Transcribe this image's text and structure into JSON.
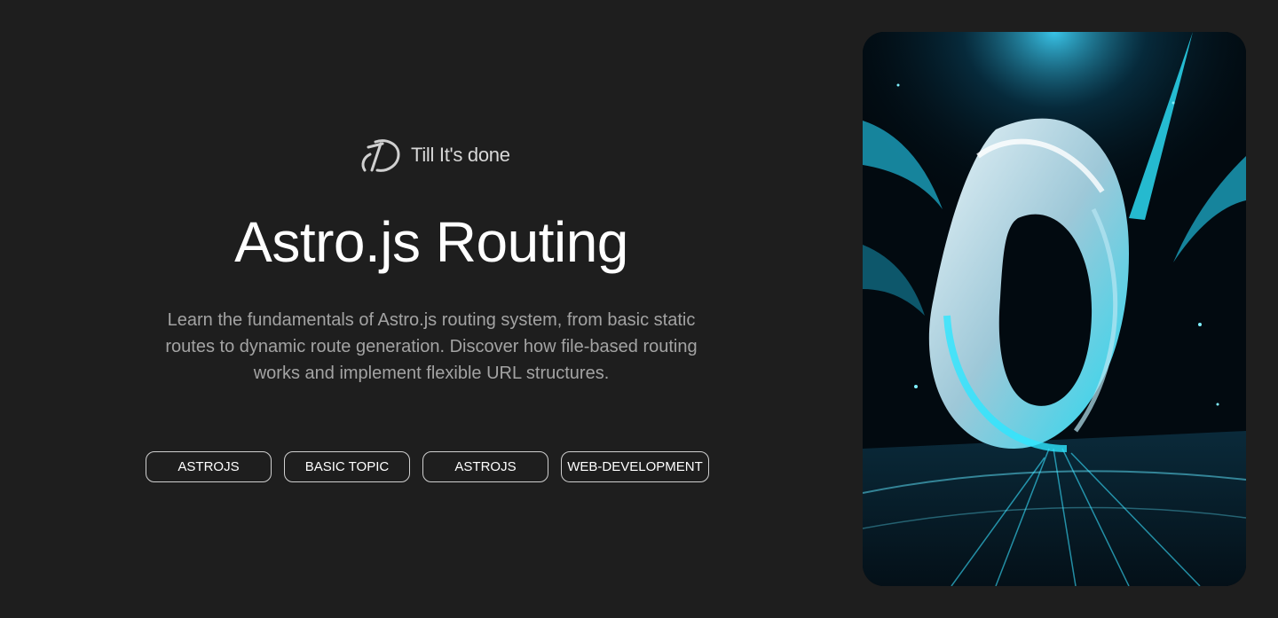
{
  "brand": {
    "name": "Till It's done",
    "logo_icon": "brand-logo-icon"
  },
  "hero": {
    "title": "Astro.js Routing",
    "description": "Learn the fundamentals of Astro.js routing system, from basic static routes to dynamic route generation. Discover how file-based routing works and implement flexible URL structures."
  },
  "tags": [
    "ASTROJS",
    "BASIC TOPIC",
    "ASTROJS",
    "WEB-DEVELOPMENT"
  ],
  "image": {
    "subject": "abstract cyan and white liquid swirl artwork",
    "accent": "#2ee6ff"
  },
  "colors": {
    "background": "#1e1e1e",
    "text": "#ffffff",
    "muted": "#a3a3a3",
    "border": "#d0d0d0"
  }
}
